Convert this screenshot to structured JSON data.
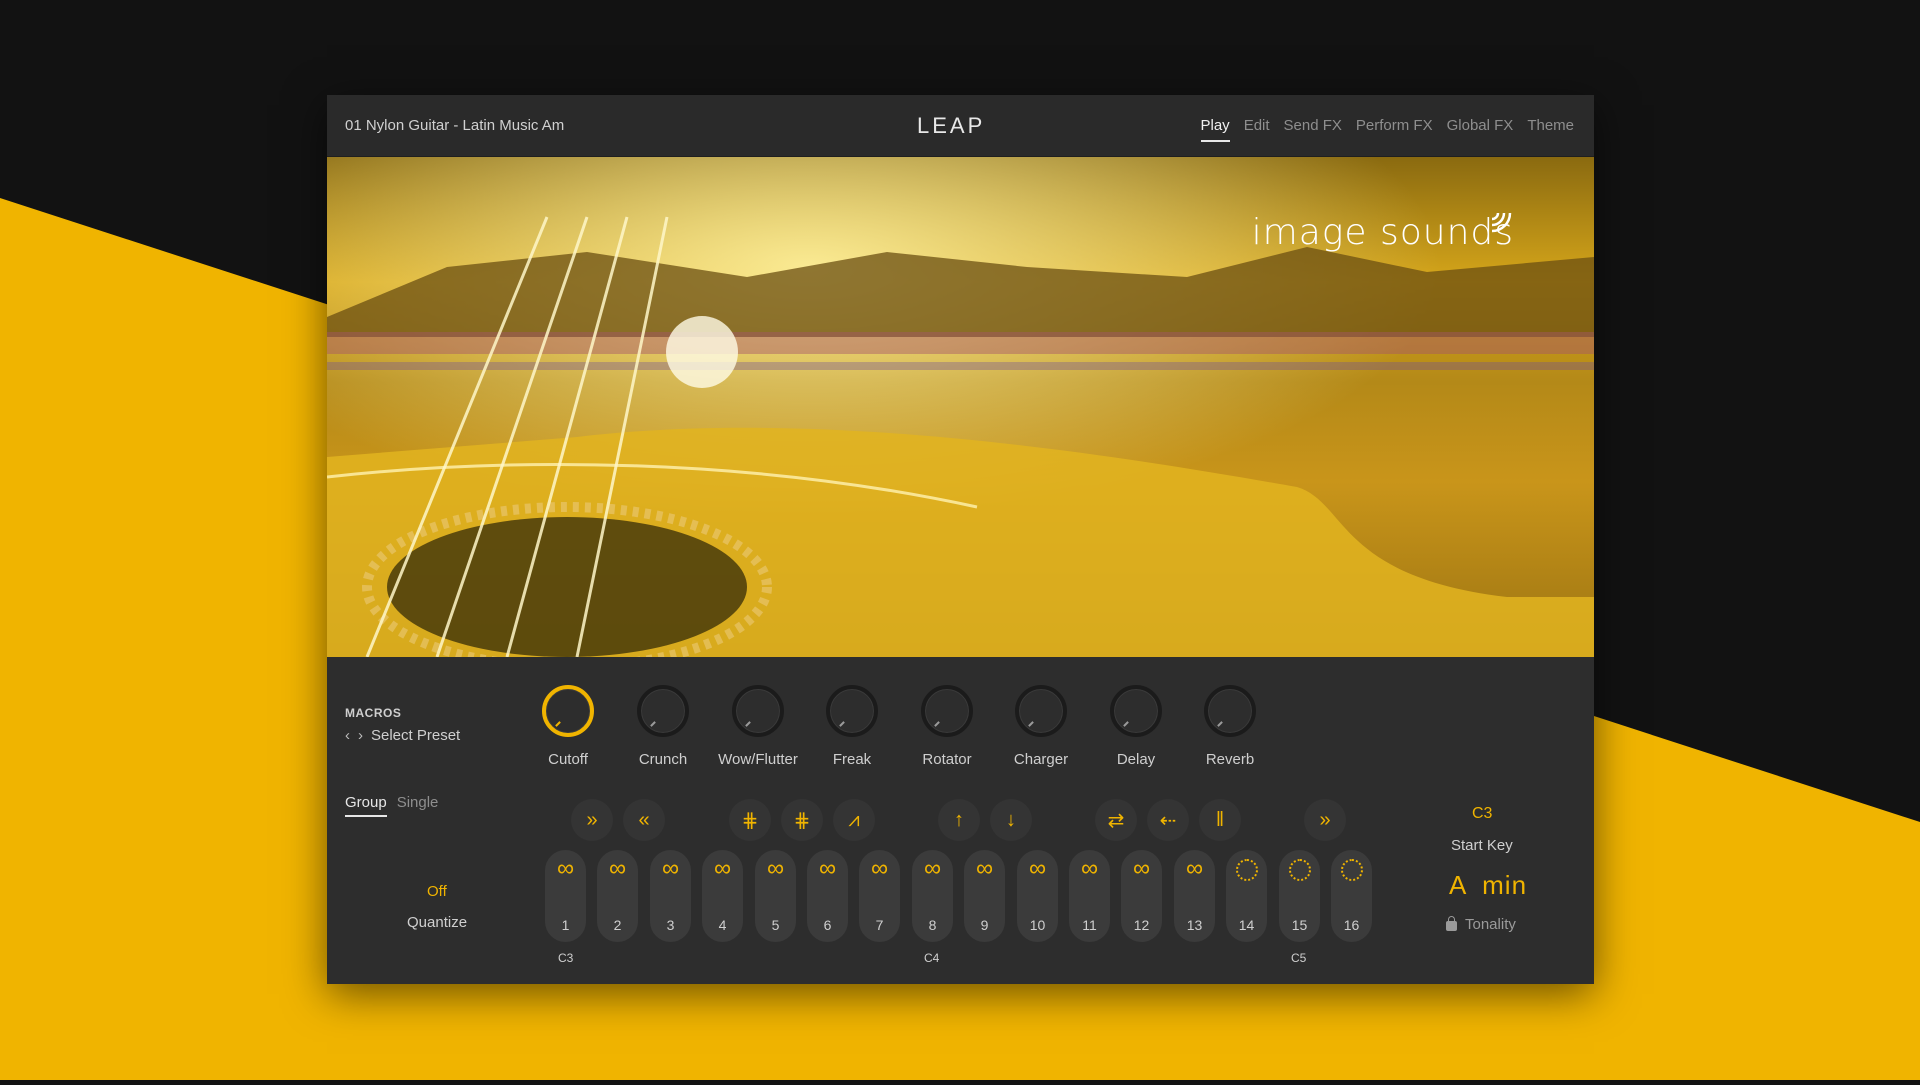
{
  "header": {
    "preset_name": "01 Nylon Guitar - Latin Music Am",
    "logo": "LEAP",
    "tabs": [
      "Play",
      "Edit",
      "Send FX",
      "Perform FX",
      "Global FX",
      "Theme"
    ],
    "active_tab": "Play"
  },
  "hero": {
    "brand_text": "image sounds",
    "brand_icon": "wifi-waves-icon"
  },
  "macros": {
    "title": "MACROS",
    "select_label": "Select Preset",
    "knobs": [
      {
        "label": "Cutoff",
        "active": true
      },
      {
        "label": "Crunch",
        "active": false
      },
      {
        "label": "Wow/Flutter",
        "active": false
      },
      {
        "label": "Freak",
        "active": false
      },
      {
        "label": "Rotator",
        "active": false
      },
      {
        "label": "Charger",
        "active": false
      },
      {
        "label": "Delay",
        "active": false
      },
      {
        "label": "Reverb",
        "active": false
      }
    ]
  },
  "mode": {
    "group": "Group",
    "single": "Single",
    "selected": "Group"
  },
  "quantize": {
    "value": "Off",
    "label": "Quantize"
  },
  "tools": [
    {
      "icon": "fast-forward-icon",
      "glyph": "»"
    },
    {
      "icon": "rewind-icon",
      "glyph": "«"
    },
    {
      "icon": "shuffle-grid-icon",
      "glyph": "⋕"
    },
    {
      "icon": "shuffle-grid-alt-icon",
      "glyph": "⋕"
    },
    {
      "icon": "envelope-icon",
      "glyph": "⩘"
    },
    {
      "icon": "arrow-up-icon",
      "glyph": "↑"
    },
    {
      "icon": "arrow-down-icon",
      "glyph": "↓"
    },
    {
      "icon": "swap-icon",
      "glyph": "⇄"
    },
    {
      "icon": "reverse-icon",
      "glyph": "⇠"
    },
    {
      "icon": "bars-icon",
      "glyph": "‖"
    },
    {
      "icon": "skip-icon",
      "glyph": "»"
    }
  ],
  "pads": [
    {
      "num": "1",
      "type": "loop"
    },
    {
      "num": "2",
      "type": "loop"
    },
    {
      "num": "3",
      "type": "loop"
    },
    {
      "num": "4",
      "type": "loop"
    },
    {
      "num": "5",
      "type": "loop"
    },
    {
      "num": "6",
      "type": "loop"
    },
    {
      "num": "7",
      "type": "loop"
    },
    {
      "num": "8",
      "type": "loop"
    },
    {
      "num": "9",
      "type": "loop"
    },
    {
      "num": "10",
      "type": "loop"
    },
    {
      "num": "11",
      "type": "loop"
    },
    {
      "num": "12",
      "type": "loop"
    },
    {
      "num": "13",
      "type": "loop"
    },
    {
      "num": "14",
      "type": "oneshot"
    },
    {
      "num": "15",
      "type": "oneshot"
    },
    {
      "num": "16",
      "type": "oneshot"
    }
  ],
  "key_labels": [
    "C3",
    "C4",
    "C5"
  ],
  "start_key": {
    "value": "C3",
    "label": "Start Key"
  },
  "tonality": {
    "value": "A  min",
    "label": "Tonality"
  },
  "colors": {
    "accent": "#f0b400",
    "panel": "#2d2d2d",
    "background": "#121212"
  }
}
